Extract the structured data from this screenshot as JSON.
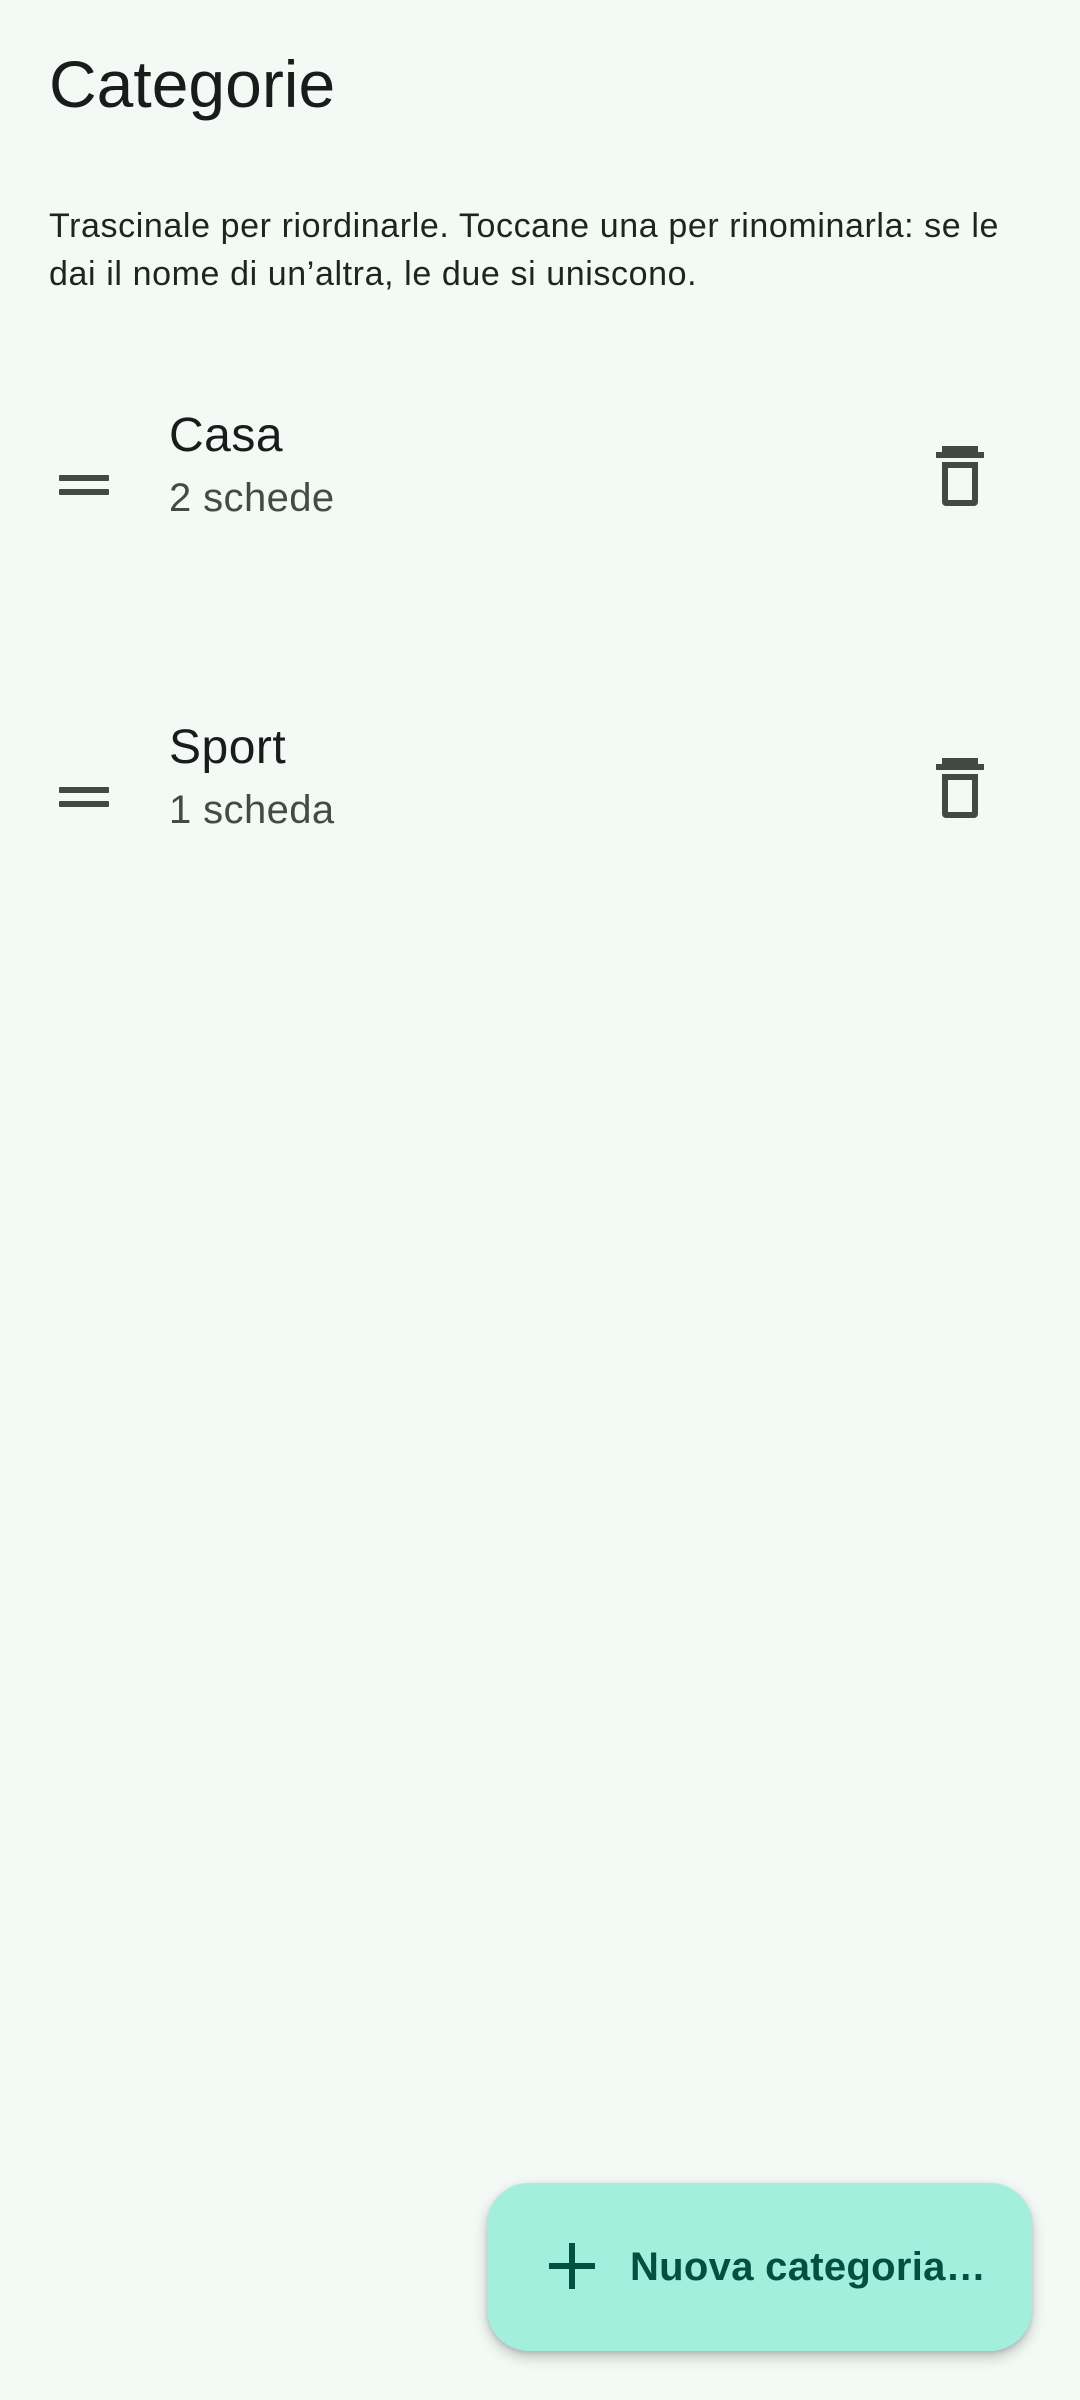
{
  "header": {
    "title": "Categorie"
  },
  "instructions": "Trascinale per riordinarle. Toccane una per rinominarla: se le dai il nome di un’altra, le due si uniscono.",
  "categories": [
    {
      "name": "Casa",
      "count": "2 schede",
      "handle_icon": "drag-handle-icon",
      "delete_icon": "trash-icon"
    },
    {
      "name": "Sport",
      "count": "1 scheda",
      "handle_icon": "drag-handle-icon",
      "delete_icon": "trash-icon"
    }
  ],
  "fab": {
    "icon": "plus-icon",
    "label": "Nuova categoria…"
  },
  "colors": {
    "background": "#f3f9f5",
    "fab_background": "#a3efdd",
    "fab_text": "#00513f",
    "icon": "#404942"
  }
}
